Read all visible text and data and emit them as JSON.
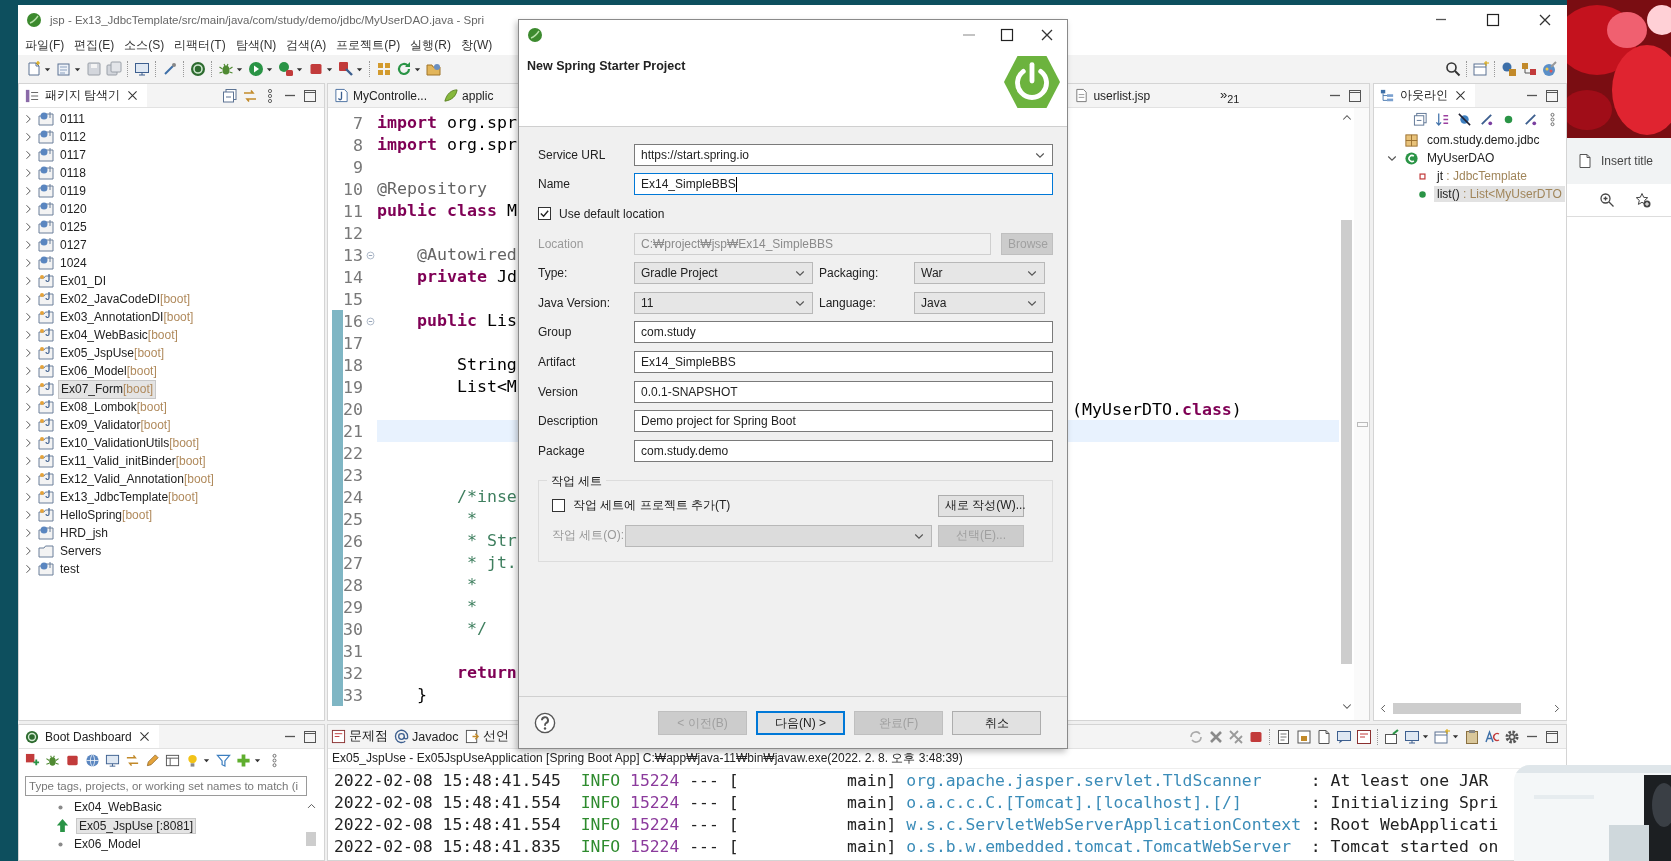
{
  "browser": {
    "tab": "Insert title"
  },
  "eclipse": {
    "title": "jsp - Ex13_JdbcTemplate/src/main/java/com/study/demo/jdbc/MyUserDAO.java - Spri",
    "menu": [
      "파일(F)",
      "편집(E)",
      "소스(S)",
      "리팩터(T)",
      "탐색(N)",
      "검색(A)",
      "프로젝트(P)",
      "실행(R)",
      "창(W)"
    ],
    "package_explorer": {
      "tab": "패키지 탐색기",
      "items": [
        {
          "name": "0111",
          "kind": "web",
          "selected": false
        },
        {
          "name": "0112",
          "kind": "web",
          "selected": false
        },
        {
          "name": "0117",
          "kind": "web",
          "selected": false
        },
        {
          "name": "0118",
          "kind": "web",
          "selected": false
        },
        {
          "name": "0119",
          "kind": "web",
          "selected": false
        },
        {
          "name": "0120",
          "kind": "web",
          "selected": false
        },
        {
          "name": "0125",
          "kind": "web",
          "selected": false
        },
        {
          "name": "0127",
          "kind": "web",
          "selected": false
        },
        {
          "name": "1024",
          "kind": "web",
          "selected": false
        },
        {
          "name": "Ex01_DI",
          "kind": "java",
          "selected": false
        },
        {
          "name": "Ex02_JavaCodeDI",
          "tag": "[boot]",
          "kind": "java",
          "selected": false
        },
        {
          "name": "Ex03_AnnotationDI",
          "tag": "[boot]",
          "kind": "java",
          "selected": false
        },
        {
          "name": "Ex04_WebBasic",
          "tag": "[boot]",
          "kind": "java",
          "selected": false
        },
        {
          "name": "Ex05_JspUse",
          "tag": "[boot]",
          "kind": "java",
          "selected": false
        },
        {
          "name": "Ex06_Model",
          "tag": "[boot]",
          "kind": "java",
          "selected": false
        },
        {
          "name": "Ex07_Form",
          "tag": "[boot]",
          "kind": "java",
          "selected": true
        },
        {
          "name": "Ex08_Lombok",
          "tag": "[boot]",
          "kind": "java",
          "selected": false
        },
        {
          "name": "Ex09_Validator",
          "tag": "[boot]",
          "kind": "java",
          "selected": false
        },
        {
          "name": "Ex10_ValidationUtils",
          "tag": "[boot]",
          "kind": "java",
          "selected": false
        },
        {
          "name": "Ex11_Valid_initBinder",
          "tag": "[boot]",
          "kind": "java",
          "selected": false
        },
        {
          "name": "Ex12_Valid_Annotation",
          "tag": "[boot]",
          "kind": "java",
          "selected": false
        },
        {
          "name": "Ex13_JdbcTemplate",
          "tag": "[boot]",
          "kind": "java",
          "selected": false
        },
        {
          "name": "HelloSpring",
          "tag": "[boot]",
          "kind": "java",
          "selected": false
        },
        {
          "name": "HRD_jsh",
          "kind": "web",
          "selected": false
        },
        {
          "name": "Servers",
          "kind": "folder",
          "selected": false
        },
        {
          "name": "test",
          "kind": "web",
          "selected": false
        }
      ]
    },
    "editor": {
      "tabs": [
        {
          "label": "MyControlle...",
          "kind": "java"
        },
        {
          "label": "applic",
          "kind": "properties"
        },
        {
          "label": "userlist.jsp",
          "kind": "jsp"
        }
      ],
      "overflow": "»$_{21}$",
      "lines": [
        {
          "num": "7",
          "tokens": [
            {
              "kind": "kw",
              "text": "import"
            },
            {
              "kind": "plain",
              "text": " org.spr"
            }
          ],
          "fold": false,
          "changed": false,
          "current": false
        },
        {
          "num": "8",
          "tokens": [
            {
              "kind": "kw",
              "text": "import"
            },
            {
              "kind": "plain",
              "text": " org.spr"
            }
          ],
          "fold": false,
          "changed": false,
          "current": false
        },
        {
          "num": "9",
          "fold": false,
          "changed": false,
          "current": false
        },
        {
          "num": "10",
          "tokens": [
            {
              "kind": "ann",
              "text": "@Repository"
            }
          ],
          "fold": false,
          "changed": false,
          "current": false
        },
        {
          "num": "11",
          "tokens": [
            {
              "kind": "kw",
              "text": "public class"
            },
            {
              "kind": "plain",
              "text": " M"
            }
          ],
          "fold": false,
          "changed": false,
          "current": false
        },
        {
          "num": "12",
          "fold": false,
          "changed": false,
          "current": false
        },
        {
          "num": "13",
          "tokens": [
            {
              "kind": "ann",
              "text": "    @Autowired"
            }
          ],
          "fold": true,
          "changed": false,
          "current": false
        },
        {
          "num": "14",
          "tokens": [
            {
              "kind": "kw",
              "text": "    private"
            },
            {
              "kind": "plain",
              "text": " Jd"
            }
          ],
          "fold": false,
          "changed": false,
          "current": false
        },
        {
          "num": "15",
          "fold": false,
          "changed": false,
          "current": false
        },
        {
          "num": "16",
          "tokens": [
            {
              "kind": "kw",
              "text": "    public"
            },
            {
              "kind": "plain",
              "text": " Lis"
            }
          ],
          "fold": true,
          "changed": true,
          "current": false
        },
        {
          "num": "17",
          "fold": false,
          "changed": true,
          "current": false
        },
        {
          "num": "18",
          "tokens": [
            {
              "kind": "plain",
              "text": "        String"
            }
          ],
          "fold": false,
          "changed": true,
          "current": false
        },
        {
          "num": "19",
          "tokens": [
            {
              "kind": "plain",
              "text": "        List<M"
            }
          ],
          "fold": false,
          "changed": true,
          "current": false
        },
        {
          "num": "20",
          "tail": [
            {
              "kind": "plain",
              "text": "(MyUserDTO."
            },
            {
              "kind": "kw",
              "text": "class"
            },
            {
              "kind": "plain",
              "text": ")"
            }
          ],
          "fold": false,
          "changed": true,
          "current": false
        },
        {
          "num": "21",
          "fold": false,
          "changed": true,
          "current": true
        },
        {
          "num": "22",
          "fold": false,
          "changed": true,
          "current": false
        },
        {
          "num": "23",
          "fold": false,
          "changed": true,
          "current": false
        },
        {
          "num": "24",
          "tokens": [
            {
              "kind": "com",
              "text": "        /*inse"
            }
          ],
          "fold": false,
          "changed": true,
          "current": false
        },
        {
          "num": "25",
          "tokens": [
            {
              "kind": "com",
              "text": "         *"
            }
          ],
          "fold": false,
          "changed": true,
          "current": false
        },
        {
          "num": "26",
          "tokens": [
            {
              "kind": "com",
              "text": "         * Str"
            }
          ],
          "fold": false,
          "changed": true,
          "current": false
        },
        {
          "num": "27",
          "tokens": [
            {
              "kind": "com",
              "text": "         * jt."
            }
          ],
          "fold": false,
          "changed": true,
          "current": false
        },
        {
          "num": "28",
          "tokens": [
            {
              "kind": "com",
              "text": "         *"
            }
          ],
          "fold": false,
          "changed": true,
          "current": false
        },
        {
          "num": "29",
          "tokens": [
            {
              "kind": "com",
              "text": "         *"
            }
          ],
          "fold": false,
          "changed": true,
          "current": false
        },
        {
          "num": "30",
          "tokens": [
            {
              "kind": "com",
              "text": "         */"
            }
          ],
          "fold": false,
          "changed": true,
          "current": false
        },
        {
          "num": "31",
          "fold": false,
          "changed": true,
          "current": false
        },
        {
          "num": "32",
          "tokens": [
            {
              "kind": "kw",
              "text": "        return"
            }
          ],
          "fold": false,
          "changed": true,
          "current": false
        },
        {
          "num": "33",
          "tokens": [
            {
              "kind": "plain",
              "text": "    }"
            }
          ],
          "fold": false,
          "changed": true,
          "current": false
        }
      ]
    },
    "outline": {
      "tab": "아웃라인",
      "items": [
        {
          "name": "com.study.demo.jdbc",
          "kind": "package",
          "selected": false
        },
        {
          "name": "MyUserDAO",
          "kind": "class",
          "selected": false,
          "expanded": true,
          "children": [
            {
              "name": "jt",
              "type": " : JdbcTemplate",
              "kind": "field",
              "selected": false
            },
            {
              "name": "list()",
              "type": " : List<MyUserDTO",
              "kind": "method",
              "selected": true
            }
          ]
        }
      ]
    },
    "boot_dashboard": {
      "tab": "Boot Dashboard",
      "filter_placeholder": "Type tags, projects, or working set names to match (i",
      "items": [
        {
          "name": "Ex04_WebBasic",
          "running": false,
          "selected": false
        },
        {
          "name": "Ex05_JspUse [:8081]",
          "running": true,
          "selected": true
        },
        {
          "name": "Ex06_Model",
          "running": false,
          "selected": false
        }
      ]
    },
    "console": {
      "tabs": [
        {
          "label": "문제점",
          "kind": "problems"
        },
        {
          "label": "Javadoc",
          "kind": "javadoc"
        },
        {
          "label": "선언",
          "kind": "declaration"
        }
      ],
      "header": "Ex05_JspUse - Ex05JspUseApplication [Spring Boot App] C:₩app₩java-11₩bin₩javaw.exe(2022. 2. 8. 오후 3:48:39)",
      "lines": [
        {
          "time": "2022-02-08 15:48:41.545",
          "level": "INFO",
          "pid": "15224",
          "sep": "--- [",
          "thread": "main]",
          "logger": "org.apache.jasper.servlet.TldScanner",
          "message": ": At least one JAR"
        },
        {
          "time": "2022-02-08 15:48:41.554",
          "level": "INFO",
          "pid": "15224",
          "sep": "--- [",
          "thread": "main]",
          "logger": "o.a.c.c.C.[Tomcat].[localhost].[/]",
          "message": ": Initializing Spri"
        },
        {
          "time": "2022-02-08 15:48:41.554",
          "level": "INFO",
          "pid": "15224",
          "sep": "--- [",
          "thread": "main]",
          "logger": "w.s.c.ServletWebServerApplicationContext",
          "message": ": Root WebApplicati"
        },
        {
          "time": "2022-02-08 15:48:41.835",
          "level": "INFO",
          "pid": "15224",
          "sep": "--- [",
          "thread": "main]",
          "logger": "o.s.b.w.embedded.tomcat.TomcatWebServer",
          "message": ": Tomcat started on"
        }
      ]
    }
  },
  "dialog": {
    "title": "New Spring Starter Project",
    "fields": [
      {
        "kind": "combo",
        "label": "Service URL",
        "value": "https://start.spring.io"
      },
      {
        "kind": "text",
        "label": "Name",
        "value": "Ex14_SimpleBBS",
        "focused": true
      },
      {
        "kind": "checkbox",
        "label": "Use default location",
        "checked": true
      },
      {
        "kind": "path",
        "label": "Location",
        "value": "C:₩project₩jsp₩Ex14_SimpleBBS",
        "button": "Browse",
        "disabled": true
      },
      {
        "kind": "pair",
        "items": [
          {
            "label": "Type:",
            "value": "Gradle Project"
          },
          {
            "label": "Packaging:",
            "value": "War"
          }
        ]
      },
      {
        "kind": "pair",
        "items": [
          {
            "label": "Java Version:",
            "value": "11"
          },
          {
            "label": "Language:",
            "value": "Java"
          }
        ]
      },
      {
        "kind": "text",
        "label": "Group",
        "value": "com.study",
        "focused": false
      },
      {
        "kind": "text",
        "label": "Artifact",
        "value": "Ex14_SimpleBBS",
        "focused": false
      },
      {
        "kind": "text",
        "label": "Version",
        "value": "0.0.1-SNAPSHOT",
        "focused": false
      },
      {
        "kind": "text",
        "label": "Description",
        "value": "Demo project for Spring Boot",
        "focused": false
      },
      {
        "kind": "text",
        "label": "Package",
        "value": "com.study.demo",
        "focused": false
      }
    ],
    "working_set": {
      "title": "작업 세트",
      "add_label": "작업 세트에 프로젝트 추가(T)",
      "add_checked": false,
      "new_button": "새로 작성(W)...",
      "set_label": "작업 세트(O):",
      "select_button": "선택(E)...",
      "disabled": true
    },
    "buttons": [
      {
        "label": "< 이전(B)",
        "disabled": true,
        "default": false
      },
      {
        "label": "다음(N) >",
        "disabled": false,
        "default": true
      },
      {
        "label": "완료(F)",
        "disabled": true,
        "default": false
      },
      {
        "label": "취소",
        "disabled": false,
        "default": false
      }
    ]
  }
}
